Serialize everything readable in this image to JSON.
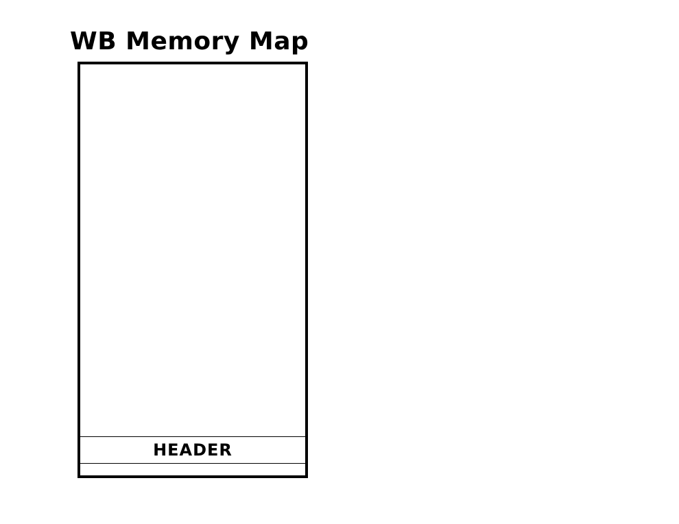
{
  "title": "WB Memory Map",
  "regions": [
    {
      "label": ""
    },
    {
      "label": "HEADER"
    },
    {
      "label": ""
    }
  ],
  "colors": {
    "stroke": "#000000",
    "background": "#ffffff"
  }
}
